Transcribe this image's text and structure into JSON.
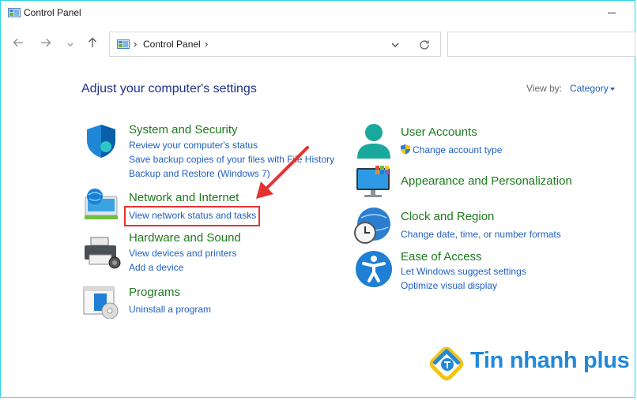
{
  "window": {
    "title": "Control Panel",
    "icon": "control-panel-icon"
  },
  "toolbar": {
    "back_icon": "back-arrow-icon",
    "forward_icon": "forward-arrow-icon",
    "recent_icon": "chevron-down-icon",
    "up_icon": "up-arrow-icon",
    "breadcrumb": "Control Panel",
    "refresh_icon": "refresh-icon",
    "search_placeholder": ""
  },
  "main": {
    "heading": "Adjust your computer's settings",
    "view_by_label": "View by:",
    "view_by_value": "Category"
  },
  "left_categories": [
    {
      "title": "System and Security",
      "icon": "shield-icon",
      "links": [
        "Review your computer's status",
        "Save backup copies of your files with File History",
        "Backup and Restore (Windows 7)"
      ]
    },
    {
      "title": "Network and Internet",
      "icon": "network-globe-icon",
      "links": [
        "View network status and tasks"
      ]
    },
    {
      "title": "Hardware and Sound",
      "icon": "printer-icon",
      "links": [
        "View devices and printers",
        "Add a device"
      ]
    },
    {
      "title": "Programs",
      "icon": "programs-disc-icon",
      "links": [
        "Uninstall a program"
      ]
    }
  ],
  "right_categories": [
    {
      "title": "User Accounts",
      "icon": "user-icon",
      "links": [
        "Change account type"
      ]
    },
    {
      "title": "Appearance and Personalization",
      "icon": "monitor-icon",
      "links": []
    },
    {
      "title": "Clock and Region",
      "icon": "clock-globe-icon",
      "links": [
        "Change date, time, or number formats"
      ]
    },
    {
      "title": "Ease of Access",
      "icon": "accessibility-icon",
      "links": [
        "Let Windows suggest settings",
        "Optimize visual display"
      ]
    }
  ],
  "annotation": {
    "highlight_color": "#e53232",
    "arrow_color": "#e53232"
  },
  "watermark": {
    "text": "Tin nhanh plus",
    "color": "#2189d8"
  },
  "colors": {
    "category_title": "#1d7a1d",
    "link": "#1f5fc2",
    "heading": "#1e3287",
    "frame": "#2fd1e6"
  }
}
